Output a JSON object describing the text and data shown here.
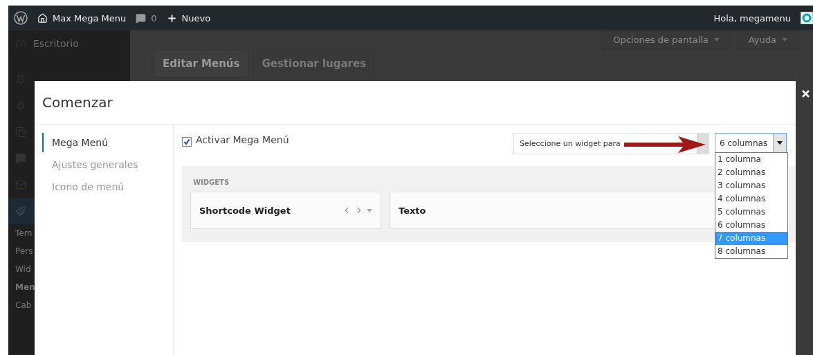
{
  "admin_bar": {
    "site": "Max Mega Menu",
    "comments": "0",
    "new": "Nuevo",
    "greeting": "Hola, megamenu"
  },
  "admin_menu": {
    "top_label": "Escritorio",
    "submenu": [
      {
        "label": "Tem",
        "current": false
      },
      {
        "label": "Pers",
        "current": false
      },
      {
        "label": "Wid",
        "current": false
      },
      {
        "label": "Men",
        "current": true
      },
      {
        "label": "Cab",
        "current": false
      }
    ]
  },
  "background_page": {
    "tabs": [
      {
        "label": "Editar Menús",
        "selected": true
      },
      {
        "label": "Gestionar lugares",
        "selected": false
      }
    ],
    "screen_buttons": [
      "Opciones de pantalla",
      "Ayuda"
    ]
  },
  "modal": {
    "title": "Comenzar",
    "nav": [
      {
        "label": "Mega Menú",
        "selected": true
      },
      {
        "label": "Ajustes generales",
        "selected": false
      },
      {
        "label": "Icono de menú",
        "selected": false
      }
    ],
    "enable": {
      "label": "Activar Mega Menú",
      "checked": true
    },
    "widget_select": {
      "value": "Seleccione un widget para"
    },
    "columns_select": {
      "value": "6 columnas",
      "expanded": true,
      "options": [
        {
          "label": "1 columna",
          "highlighted": false
        },
        {
          "label": "2 columnas",
          "highlighted": false
        },
        {
          "label": "3 columnas",
          "highlighted": false
        },
        {
          "label": "4 columnas",
          "highlighted": false
        },
        {
          "label": "5 columnas",
          "highlighted": false
        },
        {
          "label": "6 columnas",
          "highlighted": false
        },
        {
          "label": "7 columnas",
          "highlighted": true
        },
        {
          "label": "8 columnas",
          "highlighted": false
        }
      ]
    },
    "widgets_heading": "WIDGETS",
    "widgets": [
      {
        "title": "Shortcode Widget",
        "kind": "controls"
      },
      {
        "title": "Texto",
        "kind": "plain"
      }
    ]
  }
}
